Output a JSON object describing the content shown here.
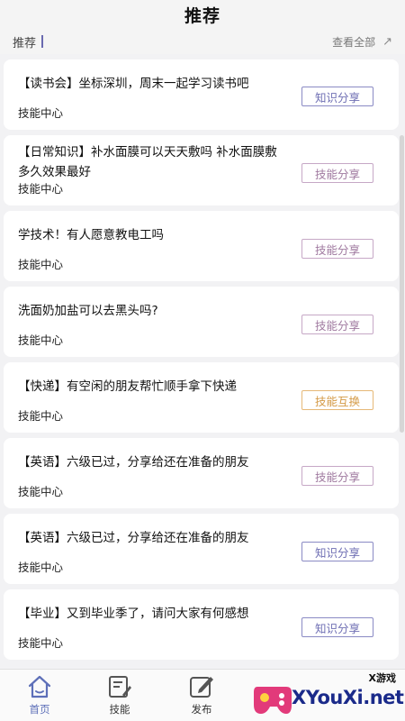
{
  "header": {
    "title": "推荐"
  },
  "section": {
    "label": "推荐",
    "view_all": "查看全部"
  },
  "posts": [
    {
      "title": "【读书会】坐标深圳，周末一起学习读书吧",
      "category": "技能中心",
      "tag": "知识分享",
      "tag_type": "knowledge"
    },
    {
      "title": "【日常知识】补水面膜可以天天敷吗 补水面膜敷多久效果最好",
      "category": "技能中心",
      "tag": "技能分享",
      "tag_type": "skill"
    },
    {
      "title": "学技术！有人愿意教电工吗",
      "category": "技能中心",
      "tag": "技能分享",
      "tag_type": "skill"
    },
    {
      "title": "洗面奶加盐可以去黑头吗?",
      "category": "技能中心",
      "tag": "技能分享",
      "tag_type": "skill"
    },
    {
      "title": "【快递】有空闲的朋友帮忙顺手拿下快递",
      "category": "技能中心",
      "tag": "技能互换",
      "tag_type": "swap"
    },
    {
      "title": "【英语】六级已过，分享给还在准备的朋友",
      "category": "技能中心",
      "tag": "技能分享",
      "tag_type": "skill"
    },
    {
      "title": "【英语】六级已过，分享给还在准备的朋友",
      "category": "技能中心",
      "tag": "知识分享",
      "tag_type": "knowledge"
    },
    {
      "title": "【毕业】又到毕业季了，请问大家有何感想",
      "category": "技能中心",
      "tag": "知识分享",
      "tag_type": "knowledge"
    }
  ],
  "tabbar": {
    "items": [
      {
        "label": "首页",
        "icon": "home-icon",
        "active": true
      },
      {
        "label": "技能",
        "icon": "notebook-edit-icon",
        "active": false
      },
      {
        "label": "发布",
        "icon": "compose-icon",
        "active": false
      }
    ]
  },
  "watermark": {
    "badge": "X游戏",
    "text": "XYouXi.net"
  },
  "colors": {
    "knowledge": "#6f6fb4",
    "skill": "#a07aa0",
    "swap": "#d49a46",
    "active_tab": "#5d6fb8"
  }
}
